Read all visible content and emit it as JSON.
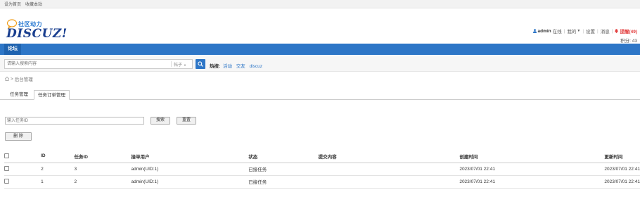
{
  "topbar": {
    "links": [
      "设为首页",
      "收藏本站"
    ]
  },
  "header": {
    "slogan": "社区动力",
    "brand": "DISCUZ!"
  },
  "user": {
    "name": "admin",
    "status": "在线",
    "links": [
      "我的",
      "设置",
      "消息"
    ],
    "remind": "提醒(49)",
    "credits": "积分: 43"
  },
  "nav": {
    "active": "论坛"
  },
  "search": {
    "placeholder": "请输入搜索内容",
    "type": "帖子",
    "hot_label": "热搜:",
    "hot_terms": [
      "活动",
      "交友",
      "discuz"
    ]
  },
  "breadcrumb": {
    "current": "后台管理"
  },
  "tabs": [
    "任务管理",
    "任务订单管理"
  ],
  "filter": {
    "placeholder": "输入任务ID",
    "search_label": "搜索",
    "reset_label": "重置",
    "delete_label": "删 除"
  },
  "table": {
    "columns": [
      "ID",
      "任务ID",
      "接单用户",
      "状态",
      "提交内容",
      "创建时间",
      "更新时间"
    ],
    "rows": [
      [
        "2",
        "3",
        "admin(UID:1)",
        "已接任务",
        "",
        "2023/07/01 22:41",
        "2023/07/01 22:41"
      ],
      [
        "1",
        "2",
        "admin(UID:1)",
        "已接任务",
        "",
        "2023/07/01 22:41",
        "2023/07/01 22:41"
      ]
    ]
  },
  "colors": {
    "primary": "#2d76c7",
    "remind": "#e23d3d"
  }
}
